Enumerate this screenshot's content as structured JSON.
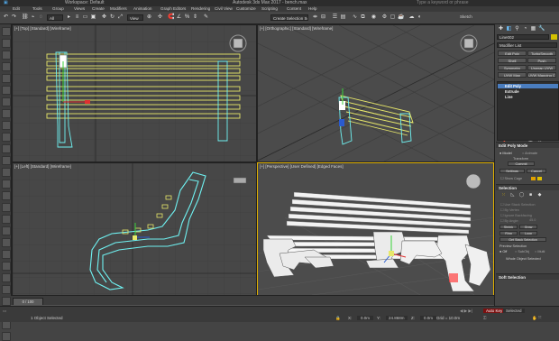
{
  "titlebar": {
    "workspace": "Workspace: Default",
    "app_title": "Autodesk 3ds Max 2017 - bench.max",
    "search_placeholder": "Type a keyword or phrase"
  },
  "menu": [
    "Edit",
    "Tools",
    "Group",
    "Views",
    "Create",
    "Modifiers",
    "Animation",
    "Graph Editors",
    "Rendering",
    "Civil View",
    "Customize",
    "Scripting",
    "Content",
    "Help"
  ],
  "toolbar": {
    "filter_dropdown": "All",
    "view_dropdown": "View",
    "selection_set": "Create Selection Se",
    "extra": "Sketch"
  },
  "viewports": {
    "top": "[+] [Top] [Standard] [Wireframe]",
    "ortho": "[+] [Orthographic] [Standard] [Wireframe]",
    "left": "[+] [Left] [Standard] [Wireframe]",
    "persp": "[+] [Perspective] [User Defined] [Edged Faces]"
  },
  "command_panel": {
    "object_name": "Line002",
    "modifier_list": "Modifier List",
    "buttons": [
      "Edit Poly",
      "TurboSmooth",
      "Shell",
      "Push",
      "Symmetry",
      "Unwrap UVW",
      "UVW Map",
      "UVW Mapping Clear"
    ],
    "stack": [
      "Edit Poly",
      "Extrude",
      "Line"
    ],
    "edit_poly_mode": "Edit Poly Mode",
    "model": "Model",
    "animate": "Animate",
    "transform": "Transform",
    "commit": "Commit",
    "settings": "Settings",
    "cancel": "Cancel",
    "show_cage": "Show Cage",
    "selection": "Selection",
    "use_stack_selection": "Use Stack Selection",
    "by_vertex": "By Vertex",
    "ignore_backfacing": "Ignore Backfacing",
    "by_angle": "By Angle:",
    "angle_value": "45.0",
    "shrink": "Shrink",
    "grow": "Grow",
    "ring": "Ring",
    "loop": "Loop",
    "get_stack_selection": "Get Stack Selection",
    "preview_selection": "Preview Selection",
    "off": "Off",
    "subobj": "SubObj",
    "multi": "Multi",
    "whole_object_selected": "Whole Object Selected",
    "soft_selection": "Soft Selection"
  },
  "timeline": {
    "frame": "0 / 100"
  },
  "status": {
    "objects_selected": "1 Object Selected",
    "x_label": "X:",
    "x_value": "0.0m",
    "y_label": "Y:",
    "y_value": "24.868m",
    "z_label": "Z:",
    "z_value": "0.0m",
    "grid": "Grid = 10.0m",
    "autokey": "Auto Key",
    "selected": "Selected"
  }
}
